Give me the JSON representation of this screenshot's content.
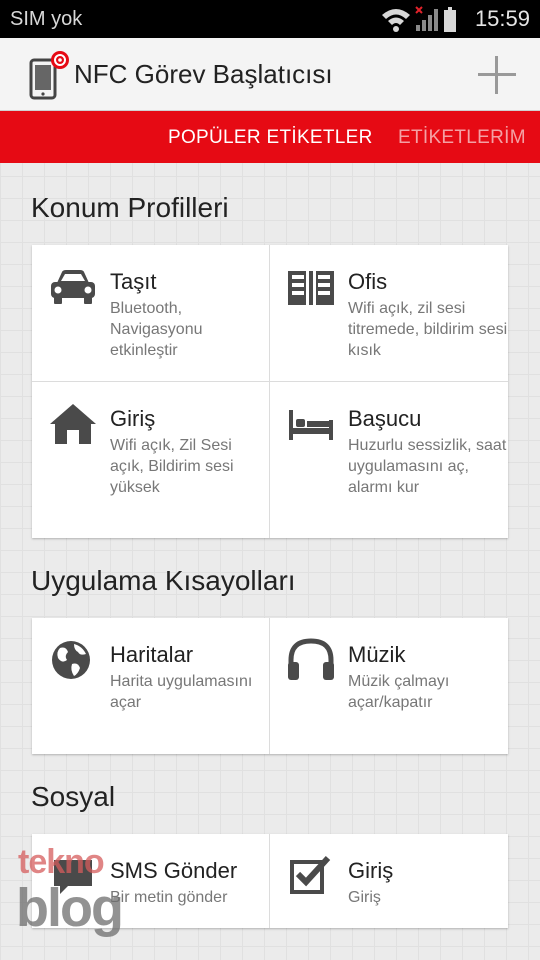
{
  "status_bar": {
    "carrier": "SIM yok",
    "time": "15:59",
    "icons": [
      "wifi-icon",
      "signal-icon",
      "battery-icon"
    ]
  },
  "app_bar": {
    "title": "NFC Görev Başlatıcısı",
    "app_icon": "nfc-phone-icon",
    "action_icon": "plus-icon"
  },
  "tabs": [
    {
      "label": "POPÜLER ETİKETLER",
      "active": true
    },
    {
      "label": "ETİKETLERİM",
      "active": false
    }
  ],
  "sections": [
    {
      "title": "Konum Profilleri",
      "items": [
        {
          "name": "Taşıt",
          "description": "Bluetooth, Navigasyonu etkinleştir",
          "icon": "car-icon"
        },
        {
          "name": "Ofis",
          "description": "Wifi açık, zil sesi titremede, bildirim sesi kısık",
          "icon": "office-building-icon"
        },
        {
          "name": "Giriş",
          "description": "Wifi açık, Zil Sesi açık, Bildirim sesi yüksek",
          "icon": "home-icon"
        },
        {
          "name": "Başucu",
          "description": "Huzurlu sessizlik, saat uygulamasını aç, alarmı kur",
          "icon": "bed-icon"
        }
      ]
    },
    {
      "title": "Uygulama Kısayolları",
      "items": [
        {
          "name": "Haritalar",
          "description": "Harita uygulamasını açar",
          "icon": "globe-icon"
        },
        {
          "name": "Müzik",
          "description": "Müzik çalmayı açar/kapatır",
          "icon": "headphones-icon"
        }
      ]
    },
    {
      "title": "Sosyal",
      "items": [
        {
          "name": "SMS Gönder",
          "description": "Bir metin gönder",
          "icon": "sms-icon"
        },
        {
          "name": "Giriş",
          "description": "Giriş",
          "icon": "checkbox-icon"
        }
      ]
    }
  ],
  "watermark": {
    "line1": "tekno",
    "line2": "blog"
  },
  "colors": {
    "accent": "#e60a14",
    "tab_inactive": "#f4a0a4",
    "icon": "#4a4a4a",
    "background": "#ebebeb"
  }
}
